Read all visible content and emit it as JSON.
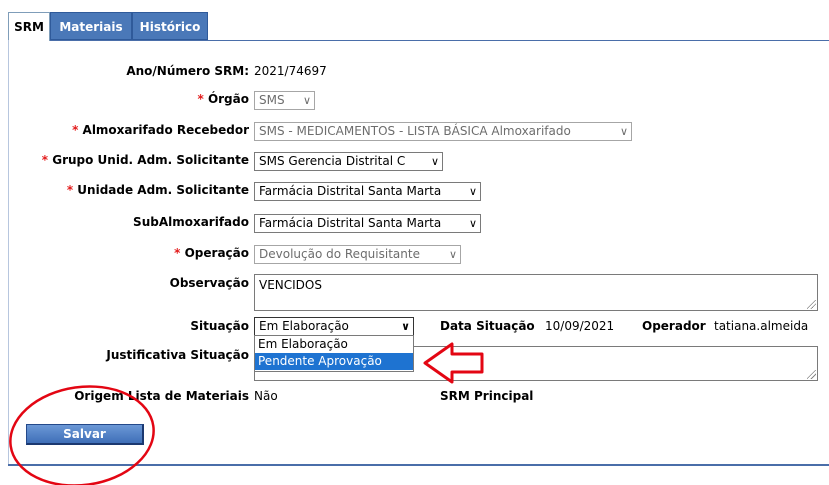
{
  "tabs": {
    "srm": "SRM",
    "materiais": "Materiais",
    "historico": "Histórico"
  },
  "fields": {
    "ano_numero": {
      "label": "Ano/Número SRM:",
      "value": "2021/74697"
    },
    "orgao": {
      "label": "Órgão",
      "value": "SMS"
    },
    "almoxarifado": {
      "label": "Almoxarifado Recebedor",
      "value": "SMS - MEDICAMENTOS - LISTA BÁSICA Almoxarifado"
    },
    "grupo_unid": {
      "label": "Grupo Unid. Adm. Solicitante",
      "value": "SMS Gerencia Distrital C"
    },
    "unidade_adm": {
      "label": "Unidade Adm. Solicitante",
      "value": "Farmácia Distrital Santa Marta"
    },
    "subalmoxarifado": {
      "label": "SubAlmoxarifado",
      "value": "Farmácia Distrital Santa Marta"
    },
    "operacao": {
      "label": "Operação",
      "value": "Devolução do Requisitante"
    },
    "observacao": {
      "label": "Observação",
      "value": "VENCIDOS"
    },
    "situacao": {
      "label": "Situação",
      "value": "Em Elaboração",
      "options": [
        "Em Elaboração",
        "Pendente Aprovação"
      ]
    },
    "data_situacao": {
      "label": "Data Situação",
      "value": "10/09/2021"
    },
    "operador": {
      "label": "Operador",
      "value": "tatiana.almeida"
    },
    "justificativa": {
      "label": "Justificativa Situação",
      "value": ""
    },
    "origem_lista": {
      "label": "Origem Lista de Materiais",
      "value": "Não"
    },
    "srm_principal": {
      "label": "SRM Principal"
    }
  },
  "required_marker": "*",
  "buttons": {
    "salvar": "Salvar"
  },
  "colors": {
    "tab_blue": "#4a78b8",
    "required_red": "#e31b1b",
    "annotation_red": "#e30613",
    "highlight_blue": "#1e73d1"
  },
  "icons": {
    "select_chevron": "chevron-down-icon",
    "annotation_arrow": "arrow-left-icon"
  }
}
